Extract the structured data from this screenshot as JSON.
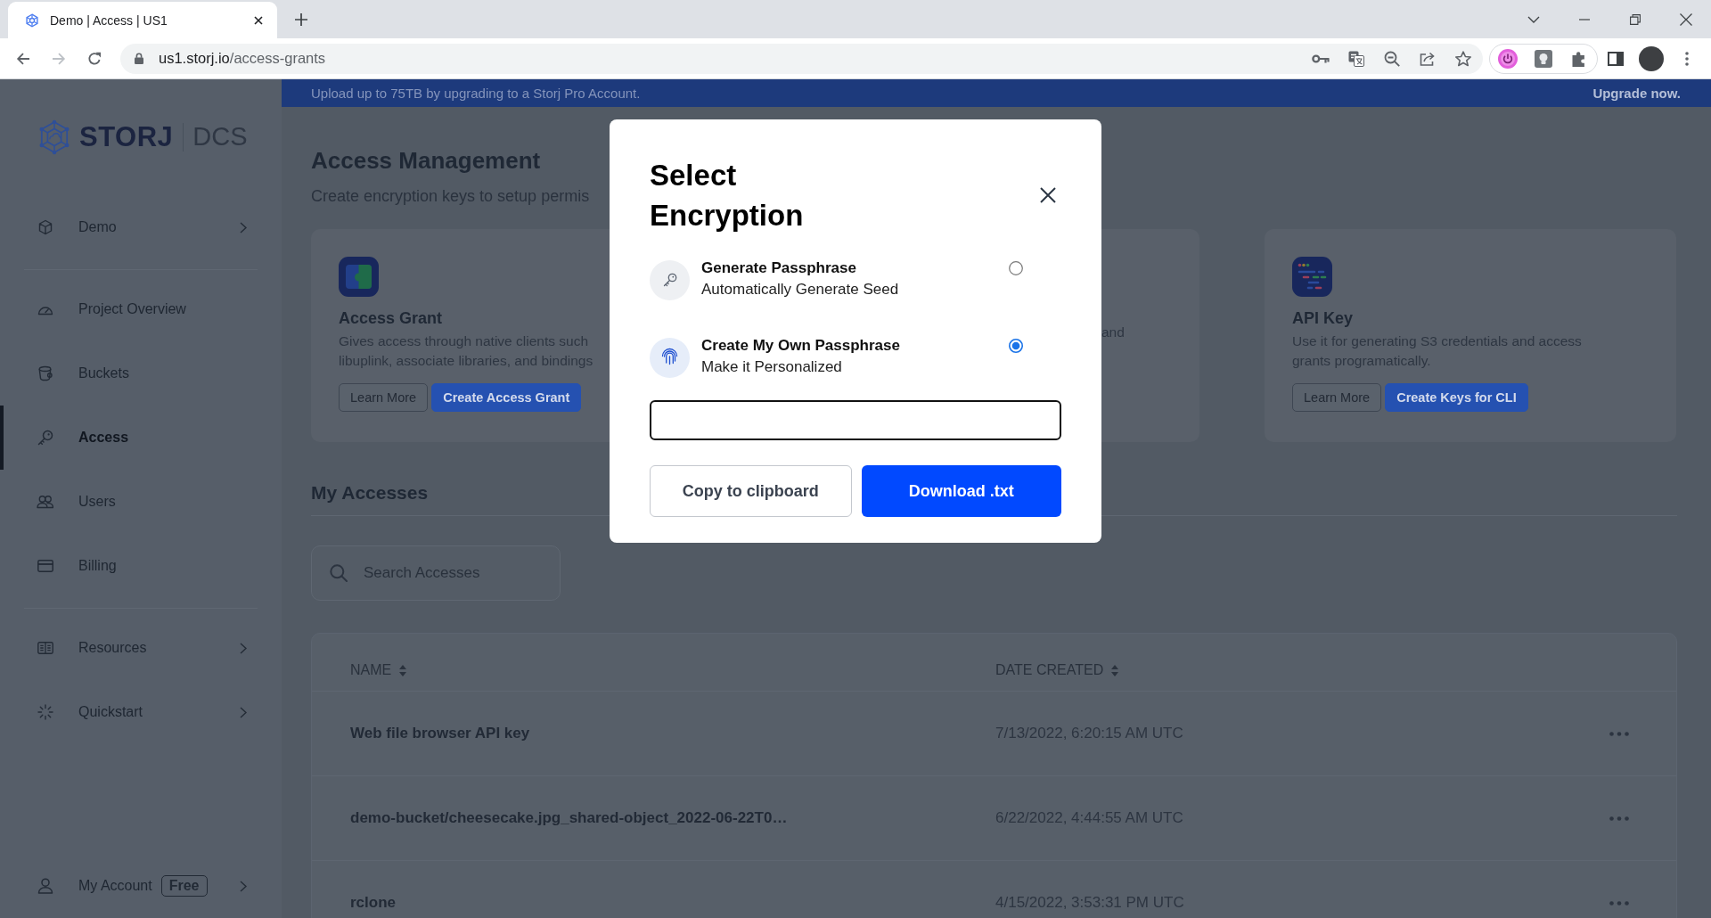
{
  "browser": {
    "tab": {
      "title": "Demo | Access | US1"
    },
    "address": {
      "host": "us1.storj.io",
      "path": "/access-grants"
    }
  },
  "sidebar": {
    "logo": {
      "name": "STORJ",
      "product": "DCS"
    },
    "sections": [
      {
        "items": [
          {
            "label": "Demo",
            "selected": false,
            "expandable": true
          }
        ]
      },
      {
        "items": [
          {
            "label": "Project Overview",
            "selected": false,
            "expandable": false
          },
          {
            "label": "Buckets",
            "selected": false,
            "expandable": false
          },
          {
            "label": "Access",
            "selected": true,
            "expandable": false
          },
          {
            "label": "Users",
            "selected": false,
            "expandable": false
          },
          {
            "label": "Billing",
            "selected": false,
            "expandable": false
          }
        ]
      },
      {
        "items": [
          {
            "label": "Resources",
            "selected": false,
            "expandable": true
          },
          {
            "label": "Quickstart",
            "selected": false,
            "expandable": true
          }
        ]
      }
    ],
    "account": {
      "label": "My Account",
      "badge": "Free",
      "selected": false,
      "expandable": true
    }
  },
  "banner": {
    "message": "Upload up to 75TB by upgrading to a Storj Pro Account.",
    "action": "Upgrade now."
  },
  "header": {
    "title": "Access Management",
    "subtitle": "Create encryption keys to setup permis"
  },
  "cards": [
    {
      "title": "Access Grant",
      "description_lines": [
        "Gives access through native clients such",
        "libuplink, associate libraries, and bindings"
      ],
      "buttons": [
        {
          "label": "Learn More",
          "kind": "secondary"
        },
        {
          "label": "Create Access Grant",
          "kind": "primary"
        }
      ]
    },
    {
      "description_lines": [
        "and"
      ]
    },
    {
      "title": "API Key",
      "description_lines": [
        "Use it for generating S3 credentials and access",
        "grants programatically."
      ],
      "buttons": [
        {
          "label": "Learn More",
          "kind": "secondary"
        },
        {
          "label": "Create Keys for CLI",
          "kind": "primary"
        }
      ]
    }
  ],
  "my_accesses": {
    "title": "My Accesses",
    "search": {
      "placeholder": "Search Accesses"
    }
  },
  "table": {
    "columns": [
      {
        "label": "NAME"
      },
      {
        "label": "DATE CREATED"
      }
    ],
    "rows": [
      {
        "name": "Web file browser API key",
        "date_created": "7/13/2022, 6:20:15 AM UTC"
      },
      {
        "name": "demo-bucket/cheesecake.jpg_shared-object_2022-06-22T0…",
        "date_created": "6/22/2022, 4:44:55 AM UTC"
      },
      {
        "name": "rclone",
        "date_created": "4/15/2022, 3:53:31 PM UTC"
      }
    ]
  },
  "modal": {
    "title": "Select Encryption",
    "options": [
      {
        "title": "Generate Passphrase",
        "subtitle": "Automatically Generate Seed",
        "selected": false
      },
      {
        "title": "Create My Own Passphrase",
        "subtitle": "Make it Personalized",
        "selected": true
      }
    ],
    "buttons": [
      {
        "label": "Copy to clipboard",
        "kind": "secondary"
      },
      {
        "label": "Download .txt",
        "kind": "primary"
      }
    ]
  }
}
